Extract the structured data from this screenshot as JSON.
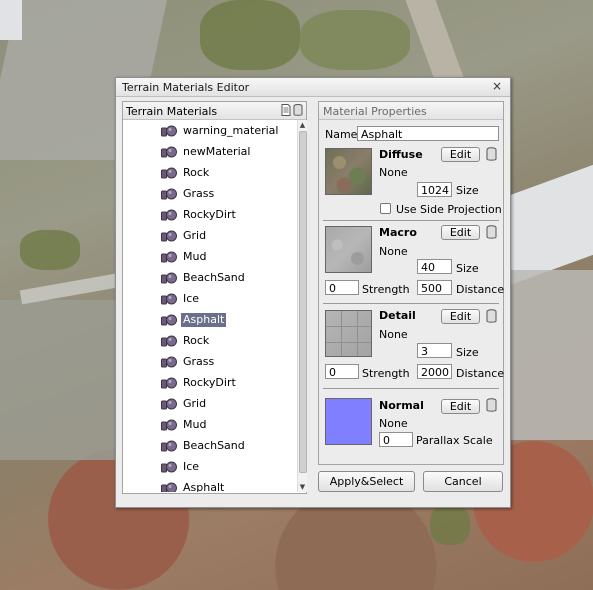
{
  "window": {
    "title": "Terrain Materials Editor",
    "close_glyph": "×"
  },
  "tree": {
    "header": "Terrain Materials",
    "items": [
      {
        "label": "warning_material"
      },
      {
        "label": "newMaterial"
      },
      {
        "label": "Rock"
      },
      {
        "label": "Grass"
      },
      {
        "label": "RockyDirt"
      },
      {
        "label": "Grid"
      },
      {
        "label": "Mud"
      },
      {
        "label": "BeachSand"
      },
      {
        "label": "Ice"
      },
      {
        "label": "Asphalt"
      },
      {
        "label": "Rock"
      },
      {
        "label": "Grass"
      },
      {
        "label": "RockyDirt"
      },
      {
        "label": "Grid"
      },
      {
        "label": "Mud"
      },
      {
        "label": "BeachSand"
      },
      {
        "label": "Ice"
      },
      {
        "label": "Asphalt"
      }
    ],
    "selected_index": 9
  },
  "props": {
    "header": "Material Properties",
    "name_label": "Name",
    "name_value": "Asphalt",
    "diffuse": {
      "title": "Diffuse",
      "edit": "Edit",
      "file": "None",
      "size_value": "1024",
      "size_label": "Size",
      "side_proj_label": "Use Side Projection"
    },
    "macro": {
      "title": "Macro",
      "edit": "Edit",
      "file": "None",
      "size_value": "40",
      "size_label": "Size",
      "strength_value": "0",
      "strength_label": "Strength",
      "distance_value": "500",
      "distance_label": "Distance"
    },
    "detail": {
      "title": "Detail",
      "edit": "Edit",
      "file": "None",
      "size_value": "3",
      "size_label": "Size",
      "strength_value": "0",
      "strength_label": "Strength",
      "distance_value": "2000",
      "distance_label": "Distance"
    },
    "normal": {
      "title": "Normal",
      "edit": "Edit",
      "file": "None",
      "parallax_value": "0",
      "parallax_label": "Parallax Scale",
      "color": "#7f7fff"
    }
  },
  "buttons": {
    "apply": "Apply&Select",
    "cancel": "Cancel"
  },
  "icons": {
    "material": "material-sphere-icon",
    "trash": "trash-icon",
    "new": "new-document-icon"
  }
}
